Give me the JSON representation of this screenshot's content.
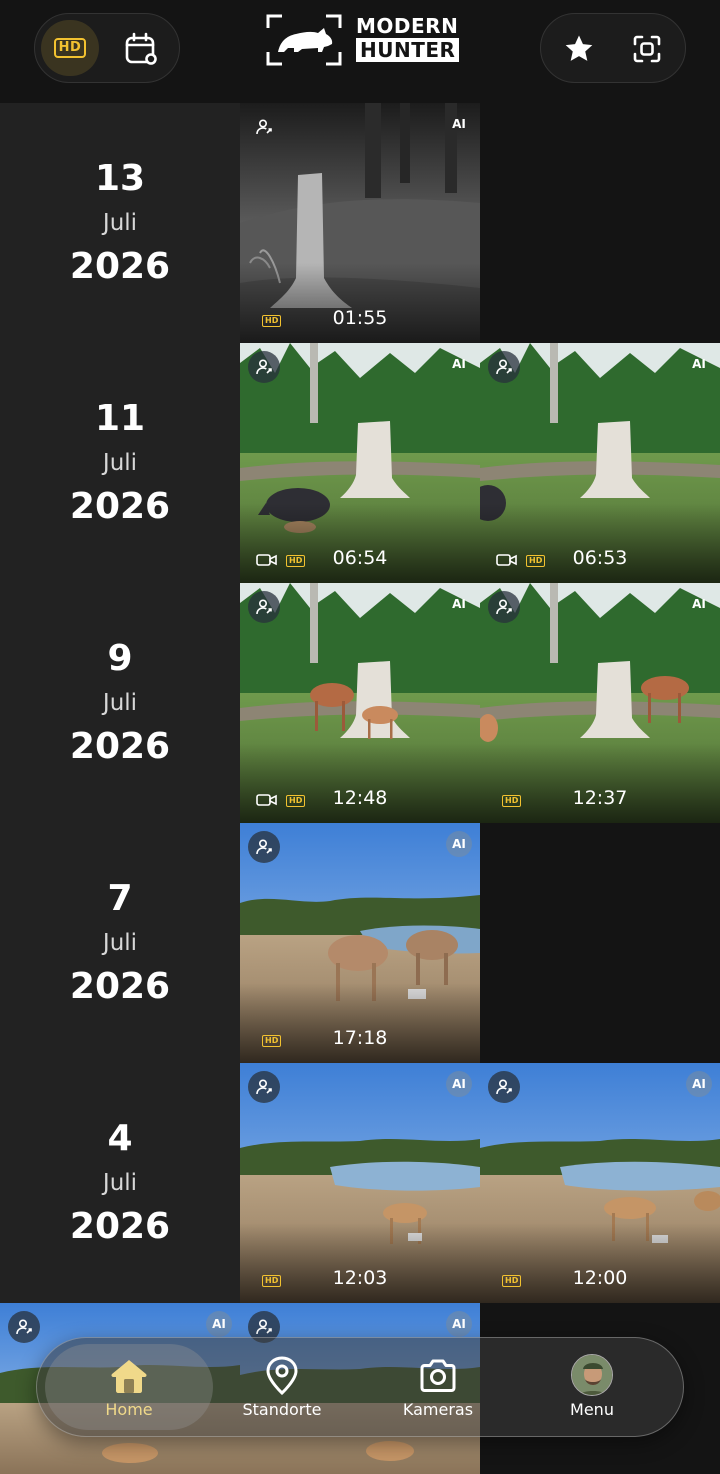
{
  "header": {
    "hd_toggle_label": "HD",
    "logo_line1": "MODERN",
    "logo_line2": "HUNTER",
    "icons": [
      "hd-icon",
      "calendar-filter-icon",
      "star-icon",
      "scan-icon"
    ]
  },
  "days": [
    {
      "day": "13",
      "month": "Juli",
      "year": "2026",
      "photos": [
        {
          "time": "01:55",
          "hd": "HD",
          "ai": "AI",
          "video": false,
          "scene": "night-forest-stump-deer"
        }
      ]
    },
    {
      "day": "11",
      "month": "Juli",
      "year": "2026",
      "photos": [
        {
          "time": "06:54",
          "hd": "HD",
          "ai": "AI",
          "video": true,
          "scene": "forest-stump-boar"
        },
        {
          "time": "06:53",
          "hd": "HD",
          "ai": "AI",
          "video": true,
          "scene": "forest-stump-boar-edge"
        }
      ]
    },
    {
      "day": "9",
      "month": "Juli",
      "year": "2026",
      "photos": [
        {
          "time": "12:48",
          "hd": "HD",
          "ai": "AI",
          "video": true,
          "scene": "forest-stump-deer-fawn"
        },
        {
          "time": "12:37",
          "hd": "HD",
          "ai": "AI",
          "video": false,
          "scene": "forest-stump-deer"
        }
      ]
    },
    {
      "day": "7",
      "month": "Juli",
      "year": "2026",
      "photos": [
        {
          "time": "17:18",
          "hd": "HD",
          "ai": "AI",
          "video": false,
          "scene": "savanna-eland"
        }
      ]
    },
    {
      "day": "4",
      "month": "Juli",
      "year": "2026",
      "photos": [
        {
          "time": "12:03",
          "hd": "HD",
          "ai": "AI",
          "video": false,
          "scene": "savanna-impala"
        },
        {
          "time": "12:00",
          "hd": "HD",
          "ai": "AI",
          "video": false,
          "scene": "savanna-impala-2"
        }
      ]
    }
  ],
  "partial_row": {
    "photos": [
      {
        "ai": "AI",
        "scene": "savanna-partial"
      },
      {
        "ai": "AI",
        "scene": "savanna-partial-2"
      }
    ]
  },
  "bottom_nav": {
    "items": [
      {
        "label": "Home",
        "icon": "home-icon",
        "active": true
      },
      {
        "label": "Standorte",
        "icon": "location-pin-icon",
        "active": false
      },
      {
        "label": "Kameras",
        "icon": "camera-icon",
        "active": false
      },
      {
        "label": "Menu",
        "icon": "avatar",
        "active": false
      }
    ]
  },
  "colors": {
    "background": "#141414",
    "date_column": "#222222",
    "accent_hd": "#f2c230",
    "active_nav_label": "#f0d98a"
  }
}
